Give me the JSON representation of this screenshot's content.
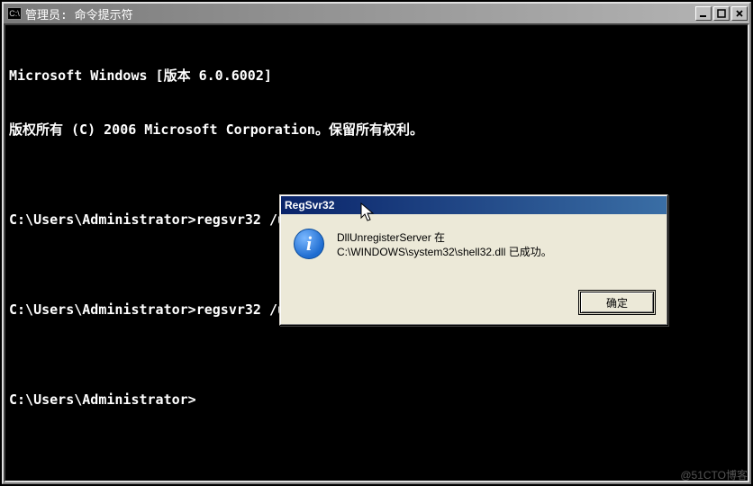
{
  "window": {
    "icon_text": "C:\\",
    "title": "管理员: 命令提示符"
  },
  "terminal": {
    "lines": [
      "Microsoft Windows [版本 6.0.6002]",
      "版权所有 (C) 2006 Microsoft Corporation。保留所有权利。",
      "",
      "C:\\Users\\Administrator>regsvr32 /u C:\\WINDOWS\\System32\\wshom.ocx",
      "",
      "C:\\Users\\Administrator>regsvr32 /u C:\\WINDOWS\\system32\\shell32.dll",
      "",
      "C:\\Users\\Administrator>"
    ]
  },
  "dialog": {
    "title": "RegSvr32",
    "line1": "DllUnregisterServer 在",
    "line2": "C:\\WINDOWS\\system32\\shell32.dll 已成功。",
    "ok_label": "确定"
  },
  "watermark": "@51CTO博客"
}
